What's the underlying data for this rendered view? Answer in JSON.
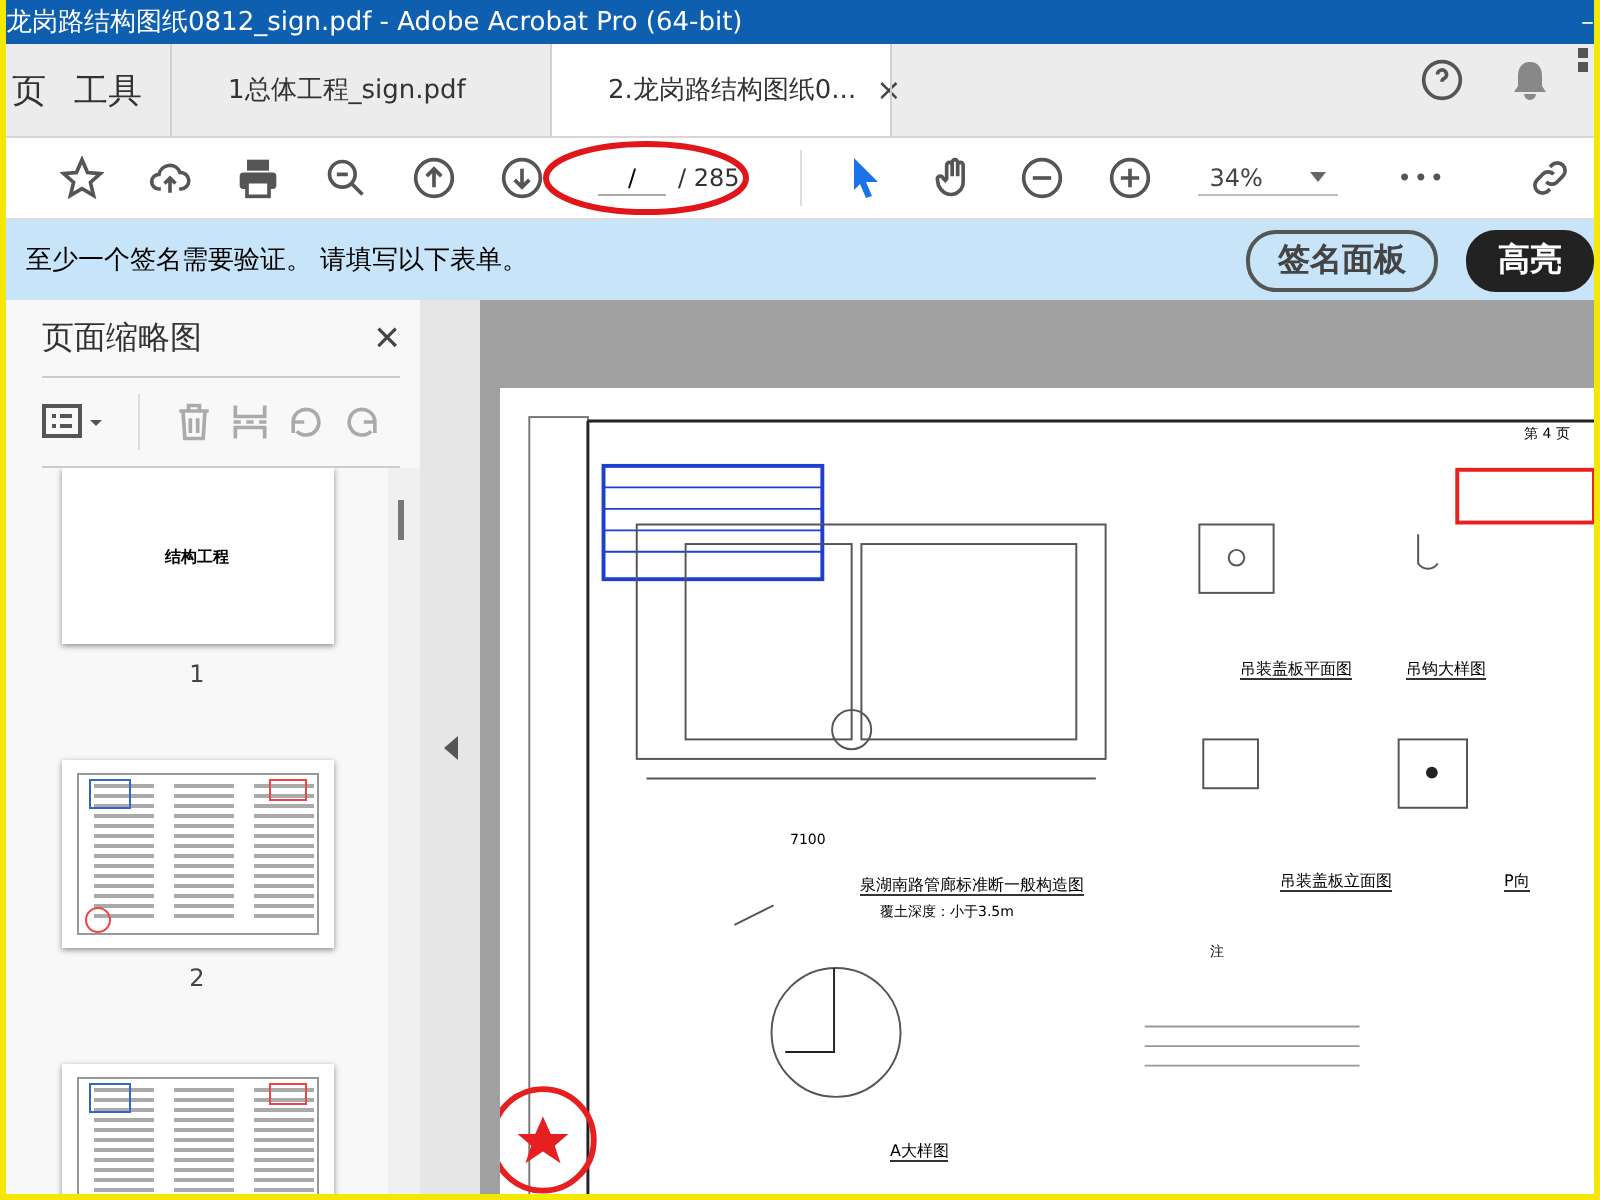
{
  "window": {
    "title": "龙岗路结构图纸0812_sign.pdf - Adobe Acrobat Pro (64-bit)",
    "minimize": "–"
  },
  "nav": [
    {
      "label": "页",
      "selected": false
    },
    {
      "label": "工具",
      "selected": false
    }
  ],
  "tabs": [
    {
      "label": "1总体工程_sign.pdf",
      "selected": false,
      "closable": false
    },
    {
      "label": "2.龙岗路结构图纸0...",
      "selected": true,
      "closable": true
    }
  ],
  "close_glyph": "×",
  "toolbar": {
    "page_value": "/",
    "page_total": "/ 285",
    "zoom": "34%",
    "more": "•••"
  },
  "sign_bar": {
    "message": "至少一个签名需要验证。 请填写以下表单。",
    "buttons": [
      {
        "label": "签名面板",
        "kind": "outline"
      },
      {
        "label": "高亮",
        "kind": "filled"
      }
    ]
  },
  "thumbnails": {
    "title": "页面缩略图",
    "close": "×",
    "pages": [
      {
        "label": "1",
        "kind": "cover",
        "heading": "结构工程"
      },
      {
        "label": "2",
        "kind": "dense"
      },
      {
        "kind": "dense"
      }
    ]
  },
  "document": {
    "page_mark": "第 4 页",
    "dimension": "7100",
    "section_title": "泉湖南路管廊标准断一般构造图",
    "cover_depth": "覆土深度：小于3.5m",
    "detail_title": "A大样图",
    "plan_title": "吊装盖板平面图",
    "hook_title": "吊钩大样图",
    "front_title": "吊装盖板立面图",
    "view_title": "P向",
    "notes_title": "注"
  }
}
